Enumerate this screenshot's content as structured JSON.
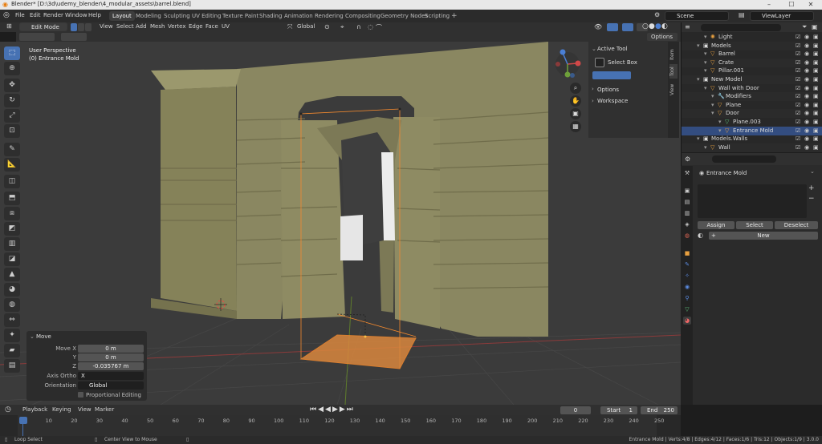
{
  "window": {
    "title": "Blender* [D:\\3d\\udemy_blender\\4_modular_assets\\barrel.blend]",
    "minimize": "–",
    "maximize": "☐",
    "close": "✕"
  },
  "menu": [
    "File",
    "Edit",
    "Render",
    "Window",
    "Help"
  ],
  "workspaces": [
    "Layout",
    "Modeling",
    "Sculpting",
    "UV Editing",
    "Texture Paint",
    "Shading",
    "Animation",
    "Rendering",
    "Compositing",
    "Geometry Nodes",
    "Scripting"
  ],
  "active_workspace": "Layout",
  "scene": "Scene",
  "view_layer": "ViewLayer",
  "viewport_header": {
    "mode": "Edit Mode",
    "menus": [
      "View",
      "Select",
      "Add",
      "Mesh",
      "Vertex",
      "Edge",
      "Face",
      "UV"
    ],
    "orientation": "Global",
    "options": "Options"
  },
  "viewport": {
    "perspective": "User Perspective",
    "object": "(0) Entrance Mold"
  },
  "n_panel": {
    "header": "Active Tool",
    "tool_name": "Select Box",
    "options": "Options",
    "workspace": "Workspace",
    "tabs": [
      "Item",
      "Tool",
      "View"
    ]
  },
  "operator": {
    "title": "Move",
    "move_x_label": "Move X",
    "move_x": "0 m",
    "y_label": "Y",
    "y": "0 m",
    "z_label": "Z",
    "z": "-0.035767 m",
    "axis_ortho_label": "Axis Ortho",
    "axis_ortho": "X",
    "orientation_label": "Orientation",
    "orientation": "Global",
    "proportional": "Proportional Editing"
  },
  "outliner": {
    "rows": [
      {
        "label": "Light",
        "indent": 2,
        "type": "light"
      },
      {
        "label": "Models",
        "indent": 1,
        "type": "collection"
      },
      {
        "label": "Barrel",
        "indent": 2,
        "type": "mesh"
      },
      {
        "label": "Crate",
        "indent": 2,
        "type": "mesh"
      },
      {
        "label": "Pillar.001",
        "indent": 2,
        "type": "mesh"
      },
      {
        "label": "New Model",
        "indent": 1,
        "type": "collection"
      },
      {
        "label": "Wall with Door",
        "indent": 2,
        "type": "mesh"
      },
      {
        "label": "Modifiers",
        "indent": 3,
        "type": "modifier"
      },
      {
        "label": "Plane",
        "indent": 3,
        "type": "mesh"
      },
      {
        "label": "Door",
        "indent": 3,
        "type": "mesh"
      },
      {
        "label": "Plane.003",
        "indent": 4,
        "type": "data"
      },
      {
        "label": "Entrance Mold",
        "indent": 4,
        "type": "mesh",
        "selected": true
      },
      {
        "label": "Models.Walls",
        "indent": 1,
        "type": "collection"
      },
      {
        "label": "Wall",
        "indent": 2,
        "type": "mesh"
      }
    ]
  },
  "properties": {
    "material_name": "Entrance Mold",
    "assign": "Assign",
    "select": "Select",
    "deselect": "Deselect",
    "new": "New"
  },
  "timeline": {
    "menus": [
      "Playback",
      "Keying",
      "View",
      "Marker"
    ],
    "current_frame": "0",
    "start_label": "Start",
    "start": "1",
    "end_label": "End",
    "end": "250",
    "ticks": [
      "0",
      "10",
      "20",
      "30",
      "40",
      "50",
      "60",
      "70",
      "80",
      "90",
      "100",
      "110",
      "120",
      "130",
      "140",
      "150",
      "160",
      "170",
      "180",
      "190",
      "200",
      "210",
      "220",
      "230",
      "240",
      "250"
    ]
  },
  "status": {
    "left": "Loop Select",
    "middle": "Center View to Mouse",
    "right": "Entrance Mold | Verts:4/8 | Edges:4/12 | Faces:1/6 | Tris:12 | Objects:1/9 | 3.0.0"
  },
  "colors": {
    "accent": "#4772b3",
    "selection": "#f58a2e",
    "wall": "#8f8c62"
  }
}
